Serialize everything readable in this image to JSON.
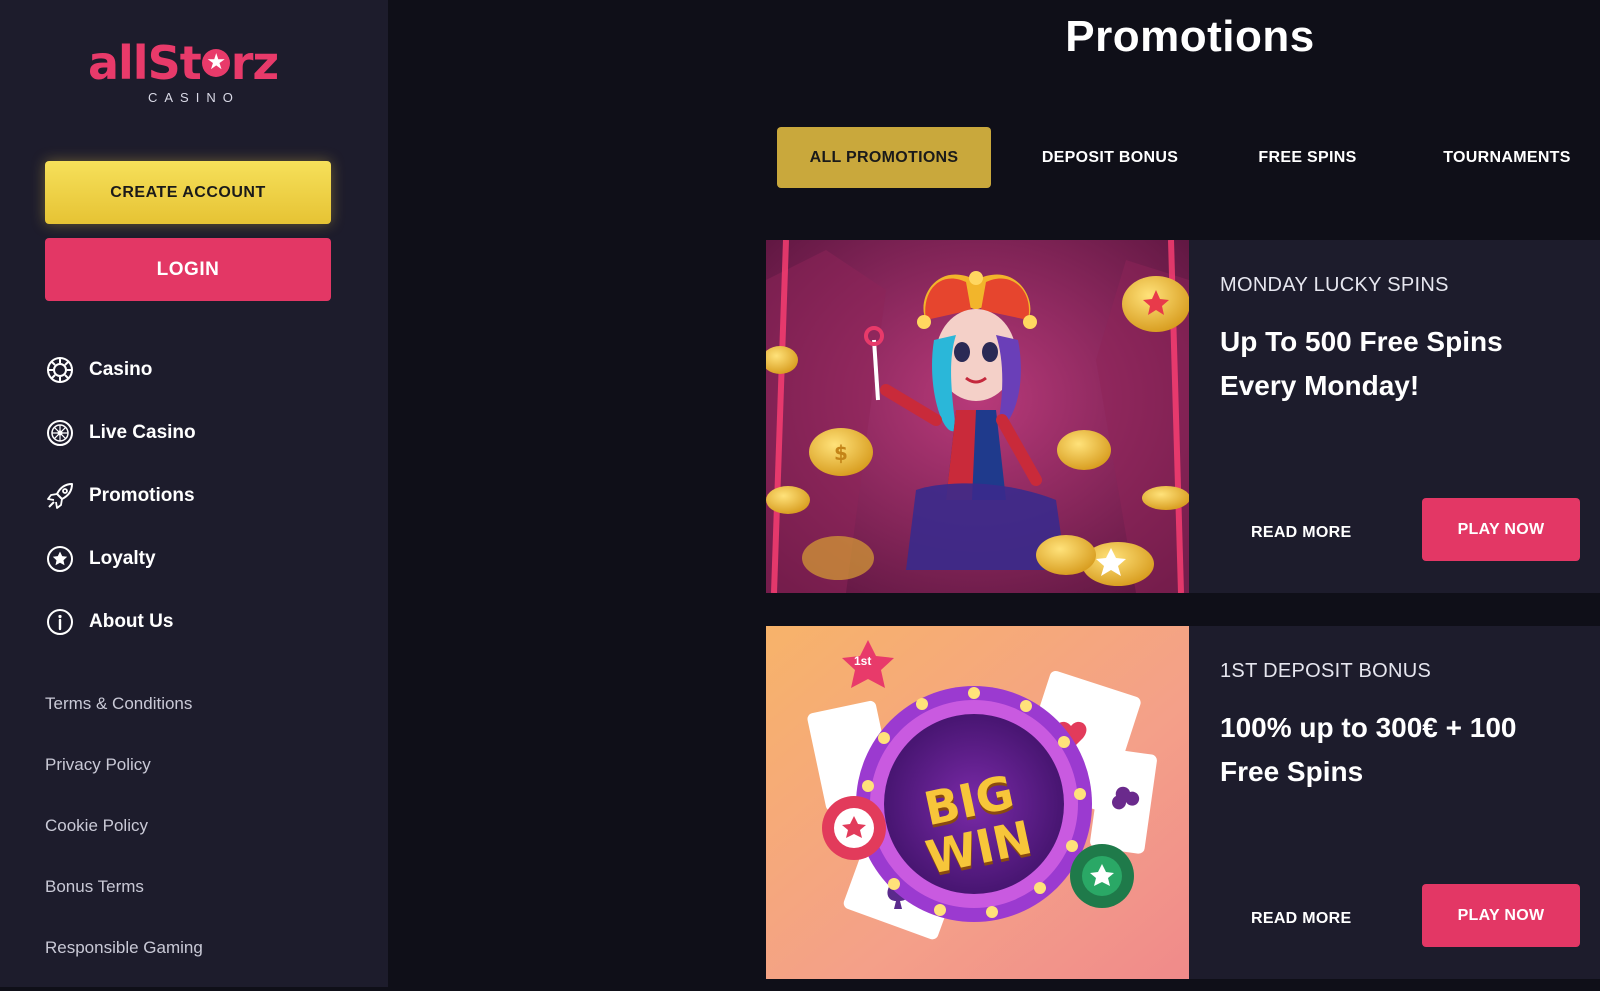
{
  "brand": {
    "logo_text": "allStarz",
    "logo_subtext": "CASINO",
    "accent": "#e33765",
    "gold": "#c9a83c"
  },
  "sidebar": {
    "create_account_label": "CREATE ACCOUNT",
    "login_label": "LOGIN",
    "nav": [
      {
        "label": "Casino",
        "icon": "casino-chip-icon"
      },
      {
        "label": "Live Casino",
        "icon": "roulette-icon"
      },
      {
        "label": "Promotions",
        "icon": "rocket-icon"
      },
      {
        "label": "Loyalty",
        "icon": "star-circle-icon"
      },
      {
        "label": "About Us",
        "icon": "info-icon"
      }
    ],
    "footer_links": [
      "Terms & Conditions",
      "Privacy Policy",
      "Cookie Policy",
      "Bonus Terms",
      "Responsible Gaming"
    ]
  },
  "main": {
    "title": "Promotions",
    "tabs": [
      {
        "label": "ALL PROMOTIONS",
        "active": true
      },
      {
        "label": "DEPOSIT BONUS",
        "active": false
      },
      {
        "label": "FREE SPINS",
        "active": false
      },
      {
        "label": "TOURNAMENTS",
        "active": false
      }
    ],
    "promotions": [
      {
        "subtitle": "MONDAY LUCKY SPINS",
        "title": "Up To 500 Free Spins Every Monday!",
        "read_more_label": "READ MORE",
        "play_label": "PLAY NOW",
        "image": "jester-character-with-coins"
      },
      {
        "subtitle": "1ST DEPOSIT BONUS",
        "title": "100% up to 300€ + 100 Free Spins",
        "read_more_label": "READ MORE",
        "play_label": "PLAY NOW",
        "image": "big-win-badge-with-cards",
        "badge_text": "1st",
        "image_text": "BIG WIN"
      }
    ]
  }
}
